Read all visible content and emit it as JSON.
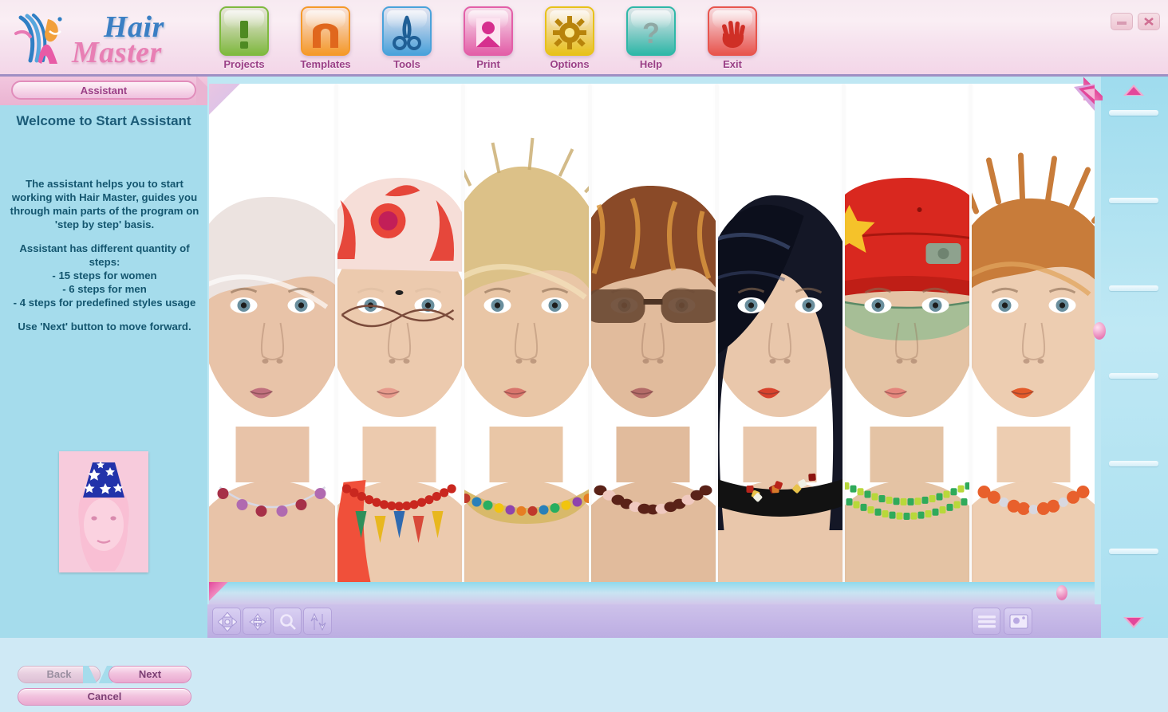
{
  "app": {
    "brand_line1": "Hair",
    "brand_line2": "Master",
    "logo_icon": "hair-master-logo-icon"
  },
  "window_controls": {
    "minimize_label": "minimize-icon",
    "close_label": "close-icon"
  },
  "toolbar": {
    "buttons": [
      {
        "label": "Projects",
        "icon": "exclamation-icon",
        "color": "#7fba3f"
      },
      {
        "label": "Templates",
        "icon": "arch-template-icon",
        "color": "#f59a2a"
      },
      {
        "label": "Tools",
        "icon": "scissors-icon",
        "color": "#4aa3db"
      },
      {
        "label": "Print",
        "icon": "portrait-print-icon",
        "color": "#e35fa8"
      },
      {
        "label": "Options",
        "icon": "gear-icon",
        "color": "#e8c21a"
      },
      {
        "label": "Help",
        "icon": "question-mark-icon",
        "color": "#2fb8a8"
      },
      {
        "label": "Exit",
        "icon": "stop-hand-icon",
        "color": "#e8564e"
      }
    ]
  },
  "sidebar": {
    "tab_label": "Assistant",
    "title": "Welcome to Start Assistant",
    "paragraphs": [
      "The assistant helps you to start working with Hair Master, guides you through main parts of  the program on 'step by step' basis.",
      "Assistant has different quantity of steps: - 15 steps for women - 6 steps for men - 4 steps for predefined styles usage",
      "Use 'Next' button to move forward."
    ],
    "body_lines": [
      "The assistant helps you to start",
      "working with Hair Master, guides you",
      "through main parts of  the program on",
      "'step by step' basis.",
      "Assistant has different quantity of",
      "steps:",
      "- 15 steps for women",
      "- 6 steps for men",
      "- 4 steps for predefined styles usage",
      "Use 'Next' button to move forward."
    ],
    "thumbnail": "pink-tinted-portrait-with-star-hat-thumbnail",
    "buttons": {
      "back": "Back",
      "next": "Next",
      "cancel": "Cancel"
    }
  },
  "gallery": {
    "items": [
      {
        "name": "platinum-blonde-short-crop",
        "hair": "#ece3e0",
        "skin": "#e8c3a8",
        "lips": "#c0707e",
        "accessory": "beaded-necklace"
      },
      {
        "name": "red-floral-bandana-with-glasses",
        "hair": "#f3d9d3",
        "skin": "#eccaae",
        "lips": "#e69a8c",
        "accessory": "red-bead-charm-necklace"
      },
      {
        "name": "tousled-golden-blonde",
        "hair": "#dcc188",
        "skin": "#e9c6a6",
        "lips": "#d8756c",
        "accessory": "jewel-collar"
      },
      {
        "name": "auburn-layered-with-sunglasses",
        "hair": "#8a4a28",
        "skin": "#e1bb9c",
        "lips": "#b36b68",
        "accessory": "wood-bead-necklace"
      },
      {
        "name": "black-asymmetric-bob",
        "hair": "#141726",
        "skin": "#e9c7ab",
        "lips": "#d8422c",
        "accessory": "black-choker"
      },
      {
        "name": "red-cap-with-green-visor",
        "hair": "#d9281f",
        "skin": "#e4c3a4",
        "lips": "#e4857c",
        "accessory": "green-bead-necklace"
      },
      {
        "name": "ginger-spiky-pixie",
        "hair": "#c87c3a",
        "skin": "#edcdb1",
        "lips": "#e35a2a",
        "accessory": "coral-bead-necklace"
      }
    ]
  },
  "bottom_toolbar": {
    "tools": [
      {
        "name": "pan-tool",
        "icon": "four-way-arrows-icon"
      },
      {
        "name": "move-tool",
        "icon": "converging-arrows-icon"
      },
      {
        "name": "zoom-tool",
        "icon": "magnifier-icon"
      },
      {
        "name": "flip-tool",
        "icon": "up-down-arrows-icon"
      }
    ],
    "right_tools": [
      {
        "name": "list-view-button",
        "icon": "list-lines-icon"
      },
      {
        "name": "photo-view-button",
        "icon": "photo-icon"
      }
    ]
  },
  "right_panel": {
    "scroll_up": "scroll-up-triangle-icon",
    "scroll_down": "scroll-down-triangle-icon",
    "divider_count": 6
  },
  "colors": {
    "header_pink": "#f6e2ee",
    "accent_pink": "#e3479a",
    "sidebar_blue": "#a5dcec",
    "label_purple": "#9a3f86",
    "bottom_lavender": "#c4b6e6"
  }
}
